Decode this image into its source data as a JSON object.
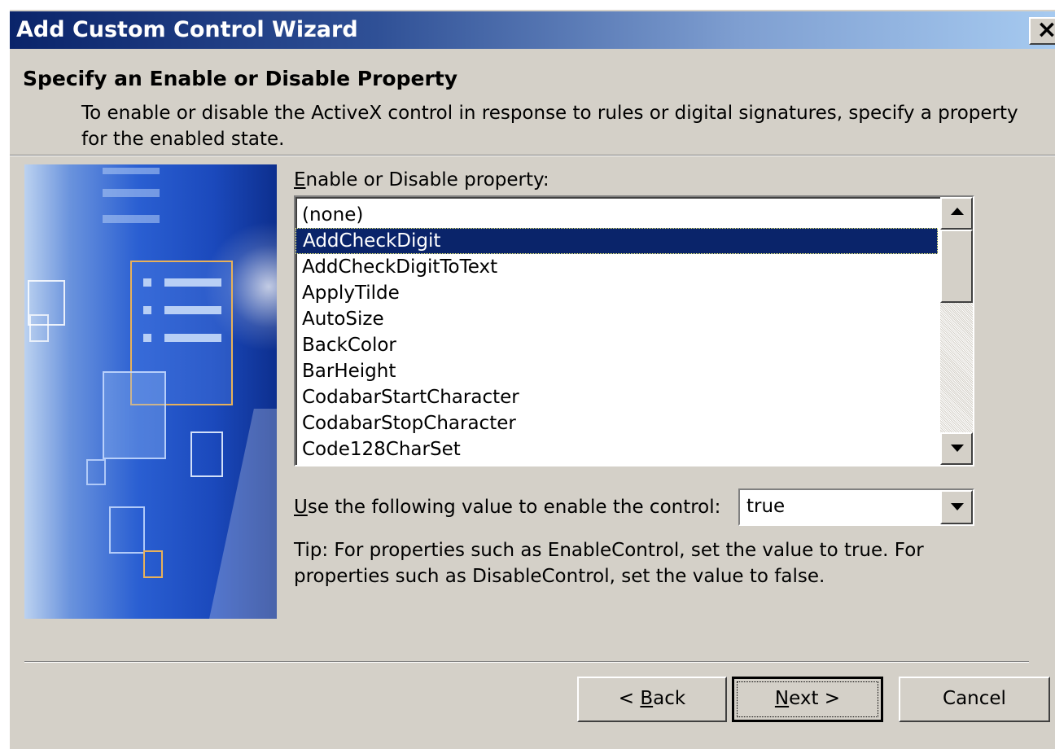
{
  "window": {
    "title": "Add Custom Control Wizard",
    "close_glyph": "×"
  },
  "page": {
    "heading": "Specify an Enable or Disable Property",
    "description": "To enable or disable the ActiveX control in response to rules or digital signatures, specify a property for the enabled state."
  },
  "property_list": {
    "label_accel": "E",
    "label_rest": "nable or Disable property:",
    "items": [
      "(none)",
      "AddCheckDigit",
      "AddCheckDigitToText",
      "ApplyTilde",
      "AutoSize",
      "BackColor",
      "BarHeight",
      "CodabarStartCharacter",
      "CodabarStopCharacter",
      "Code128CharSet"
    ],
    "selected": "AddCheckDigit"
  },
  "value_field": {
    "label_accel": "U",
    "label_rest": "se the following value to enable the control:",
    "value": "true"
  },
  "tip": "Tip: For properties such as EnableControl, set the value to true. For properties such as DisableControl, set the value to false.",
  "buttons": {
    "back_pre": "< ",
    "back_accel": "B",
    "back_rest": "ack",
    "next_accel": "N",
    "next_rest": "ext >",
    "cancel": "Cancel"
  },
  "icons": [
    "close-icon",
    "scroll-up-icon",
    "scroll-down-icon",
    "dropdown-arrow-icon",
    "wizard-graphic"
  ]
}
